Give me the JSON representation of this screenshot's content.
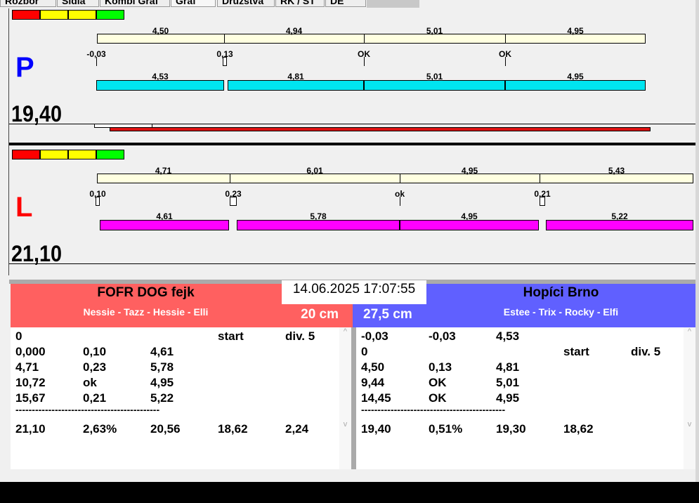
{
  "tabs": [
    "Rozbor",
    "Sídla",
    "Kombi Graf",
    "Graf",
    "Družstva",
    "RK / ST",
    "DE"
  ],
  "lane_p": {
    "side": "P",
    "total": "19,40",
    "run_times": [
      "4,50",
      "4,94",
      "5,01",
      "4,95"
    ],
    "reactions": [
      "-0,03",
      "0,13",
      "OK",
      "OK"
    ],
    "split_times": [
      "4,53",
      "4,81",
      "5,01",
      "4,95"
    ],
    "bar_color": "#00e5f0"
  },
  "lane_l": {
    "side": "L",
    "total": "21,10",
    "run_times": [
      "4,71",
      "6,01",
      "4,95",
      "5,43"
    ],
    "reactions": [
      "0,10",
      "0,23",
      "ok",
      "0,21"
    ],
    "split_times": [
      "4,61",
      "5,78",
      "4,95",
      "5,22"
    ],
    "bar_color": "#ff00ff"
  },
  "datetime": "14.06.2025 17:07:55",
  "left_team": {
    "name": "FOFR DOG fejk",
    "dogs": "Nessie - Tazz - Hessie - Elli",
    "height": "20 cm",
    "color": "#ff6060",
    "rows": [
      [
        "0",
        "",
        "",
        "start",
        "div. 5"
      ],
      [
        "0,000",
        "0,10",
        "4,61",
        "",
        ""
      ],
      [
        "4,71",
        "0,23",
        "5,78",
        "",
        ""
      ],
      [
        "10,72",
        "ok",
        "4,95",
        "",
        ""
      ],
      [
        "15,67",
        "0,21",
        "5,22",
        "",
        ""
      ]
    ],
    "separator": "--------------------------------------------",
    "summary": [
      "21,10",
      "2,63%",
      "20,56",
      "18,62",
      "2,24"
    ]
  },
  "right_team": {
    "name": "Hopíci Brno",
    "dogs": "Estee - Trix - Rocky - Elfi",
    "height": "27,5 cm",
    "color": "#6060ff",
    "rows": [
      [
        "-0,03",
        "-0,03",
        "4,53",
        "",
        ""
      ],
      [
        "0",
        "",
        "",
        "start",
        "div. 5"
      ],
      [
        "4,50",
        "0,13",
        "4,81",
        "",
        ""
      ],
      [
        "9,44",
        "OK",
        "5,01",
        "",
        ""
      ],
      [
        "14,45",
        "OK",
        "4,95",
        "",
        ""
      ]
    ],
    "separator": "--------------------------------------------",
    "summary": [
      "19,40",
      "0,51%",
      "19,30",
      "18,62",
      ""
    ]
  }
}
